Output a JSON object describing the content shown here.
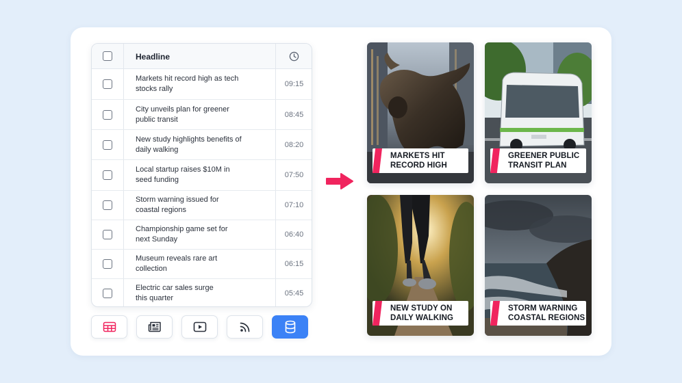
{
  "table": {
    "header": {
      "headline_label": "Headline",
      "time_icon": "clock-icon"
    },
    "rows": [
      {
        "line1": "Markets hit record high as tech",
        "line2": "stocks rally",
        "time": "09:15"
      },
      {
        "line1": "City unveils plan for greener",
        "line2": "public transit",
        "time": "08:45"
      },
      {
        "line1": "New study highlights benefits of",
        "line2": "daily walking",
        "time": "08:20"
      },
      {
        "line1": "Local startup raises $10M in",
        "line2": "seed funding",
        "time": "07:50"
      },
      {
        "line1": "Storm warning issued for",
        "line2": "coastal regions",
        "time": "07:10"
      },
      {
        "line1": "Championship game set for",
        "line2": "next Sunday",
        "time": "06:40"
      },
      {
        "line1": "Museum reveals rare art",
        "line2": "collection",
        "time": "06:15"
      },
      {
        "line1": "Electric car sales surge",
        "line2": "this quarter",
        "time": "05:45"
      }
    ]
  },
  "toolbar": {
    "buttons": [
      {
        "icon": "table-icon",
        "active": false
      },
      {
        "icon": "newspaper-icon",
        "active": false
      },
      {
        "icon": "video-play-icon",
        "active": false
      },
      {
        "icon": "rss-feed-icon",
        "active": false
      },
      {
        "icon": "database-icon",
        "active": true
      }
    ]
  },
  "arrow_icon": "right-arrow-icon",
  "colors": {
    "accent": "#f0245e",
    "active": "#3b82f6",
    "background": "#e3eefa"
  },
  "tiles": [
    {
      "line1": "MARKETS HIT",
      "line2": "RECORD HIGH"
    },
    {
      "line1": "GREENER PUBLIC",
      "line2": "TRANSIT PLAN"
    },
    {
      "line1": "NEW STUDY ON",
      "line2": "DAILY WALKING"
    },
    {
      "line1": "STORM WARNING",
      "line2": "COASTAL REGIONS"
    }
  ]
}
